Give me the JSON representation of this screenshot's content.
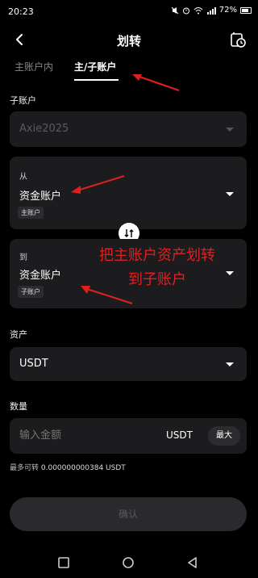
{
  "status_bar": {
    "time": "20:23",
    "battery": "72%",
    "icons": [
      "mute-icon",
      "alarm-icon",
      "wifi-icon",
      "signal-icon",
      "battery-icon"
    ]
  },
  "header": {
    "title": "划转",
    "back_icon": "back-arrow-icon",
    "history_icon": "history-icon"
  },
  "tabs": [
    {
      "label": "主账户内",
      "active": false
    },
    {
      "label": "主/子账户",
      "active": true
    }
  ],
  "subaccount": {
    "label": "子账户",
    "value": "Axie2025"
  },
  "from": {
    "label": "从",
    "account": "资金账户",
    "tag": "主账户"
  },
  "to": {
    "label": "到",
    "account": "资金账户",
    "tag": "子账户"
  },
  "annotation": {
    "line1": "把主账户资产划转",
    "line2": "到子账户",
    "color": "#e02020"
  },
  "asset": {
    "label": "资产",
    "value": "USDT"
  },
  "amount": {
    "label": "数量",
    "placeholder": "输入金额",
    "unit": "USDT",
    "max_label": "最大"
  },
  "max_transfer": {
    "label": "最多可转",
    "value": "0.000000000384 USDT"
  },
  "confirm_label": "确认",
  "nav": [
    "square-icon",
    "circle-icon",
    "triangle-back-icon"
  ]
}
